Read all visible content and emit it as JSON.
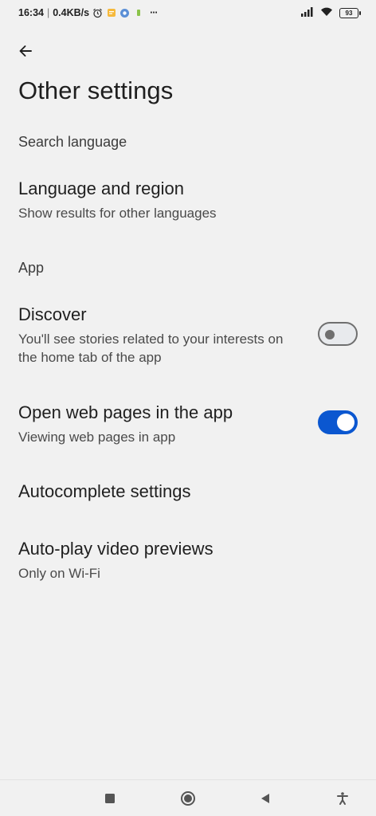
{
  "status_bar": {
    "time": "16:34",
    "separator": "|",
    "speed": "0.4KB/s",
    "more": "···",
    "battery": "93"
  },
  "header": {
    "back_icon": "arrow-left-icon",
    "title": "Other settings"
  },
  "sections": {
    "search_language": {
      "header": "Search language",
      "language_region": {
        "title": "Language and region",
        "subtitle": "Show results for other languages"
      }
    },
    "app": {
      "header": "App",
      "discover": {
        "title": "Discover",
        "subtitle_line1": "You'll see stories related to your interests on",
        "subtitle_line2": "the home tab of the app",
        "enabled": false
      },
      "open_web_pages": {
        "title": "Open web pages in the app",
        "subtitle": "Viewing web pages in app",
        "enabled": true
      },
      "autocomplete": {
        "title": "Autocomplete settings"
      },
      "autoplay": {
        "title": "Auto-play video previews",
        "subtitle": "Only on Wi-Fi"
      }
    }
  },
  "colors": {
    "background": "#f1f1f1",
    "toggle_on": "#0b57d0",
    "toggle_off_track": "#e8eaed"
  },
  "nav_bar": {
    "icons": [
      "square-recents-icon",
      "circle-home-icon",
      "triangle-back-icon",
      "accessibility-icon"
    ]
  }
}
